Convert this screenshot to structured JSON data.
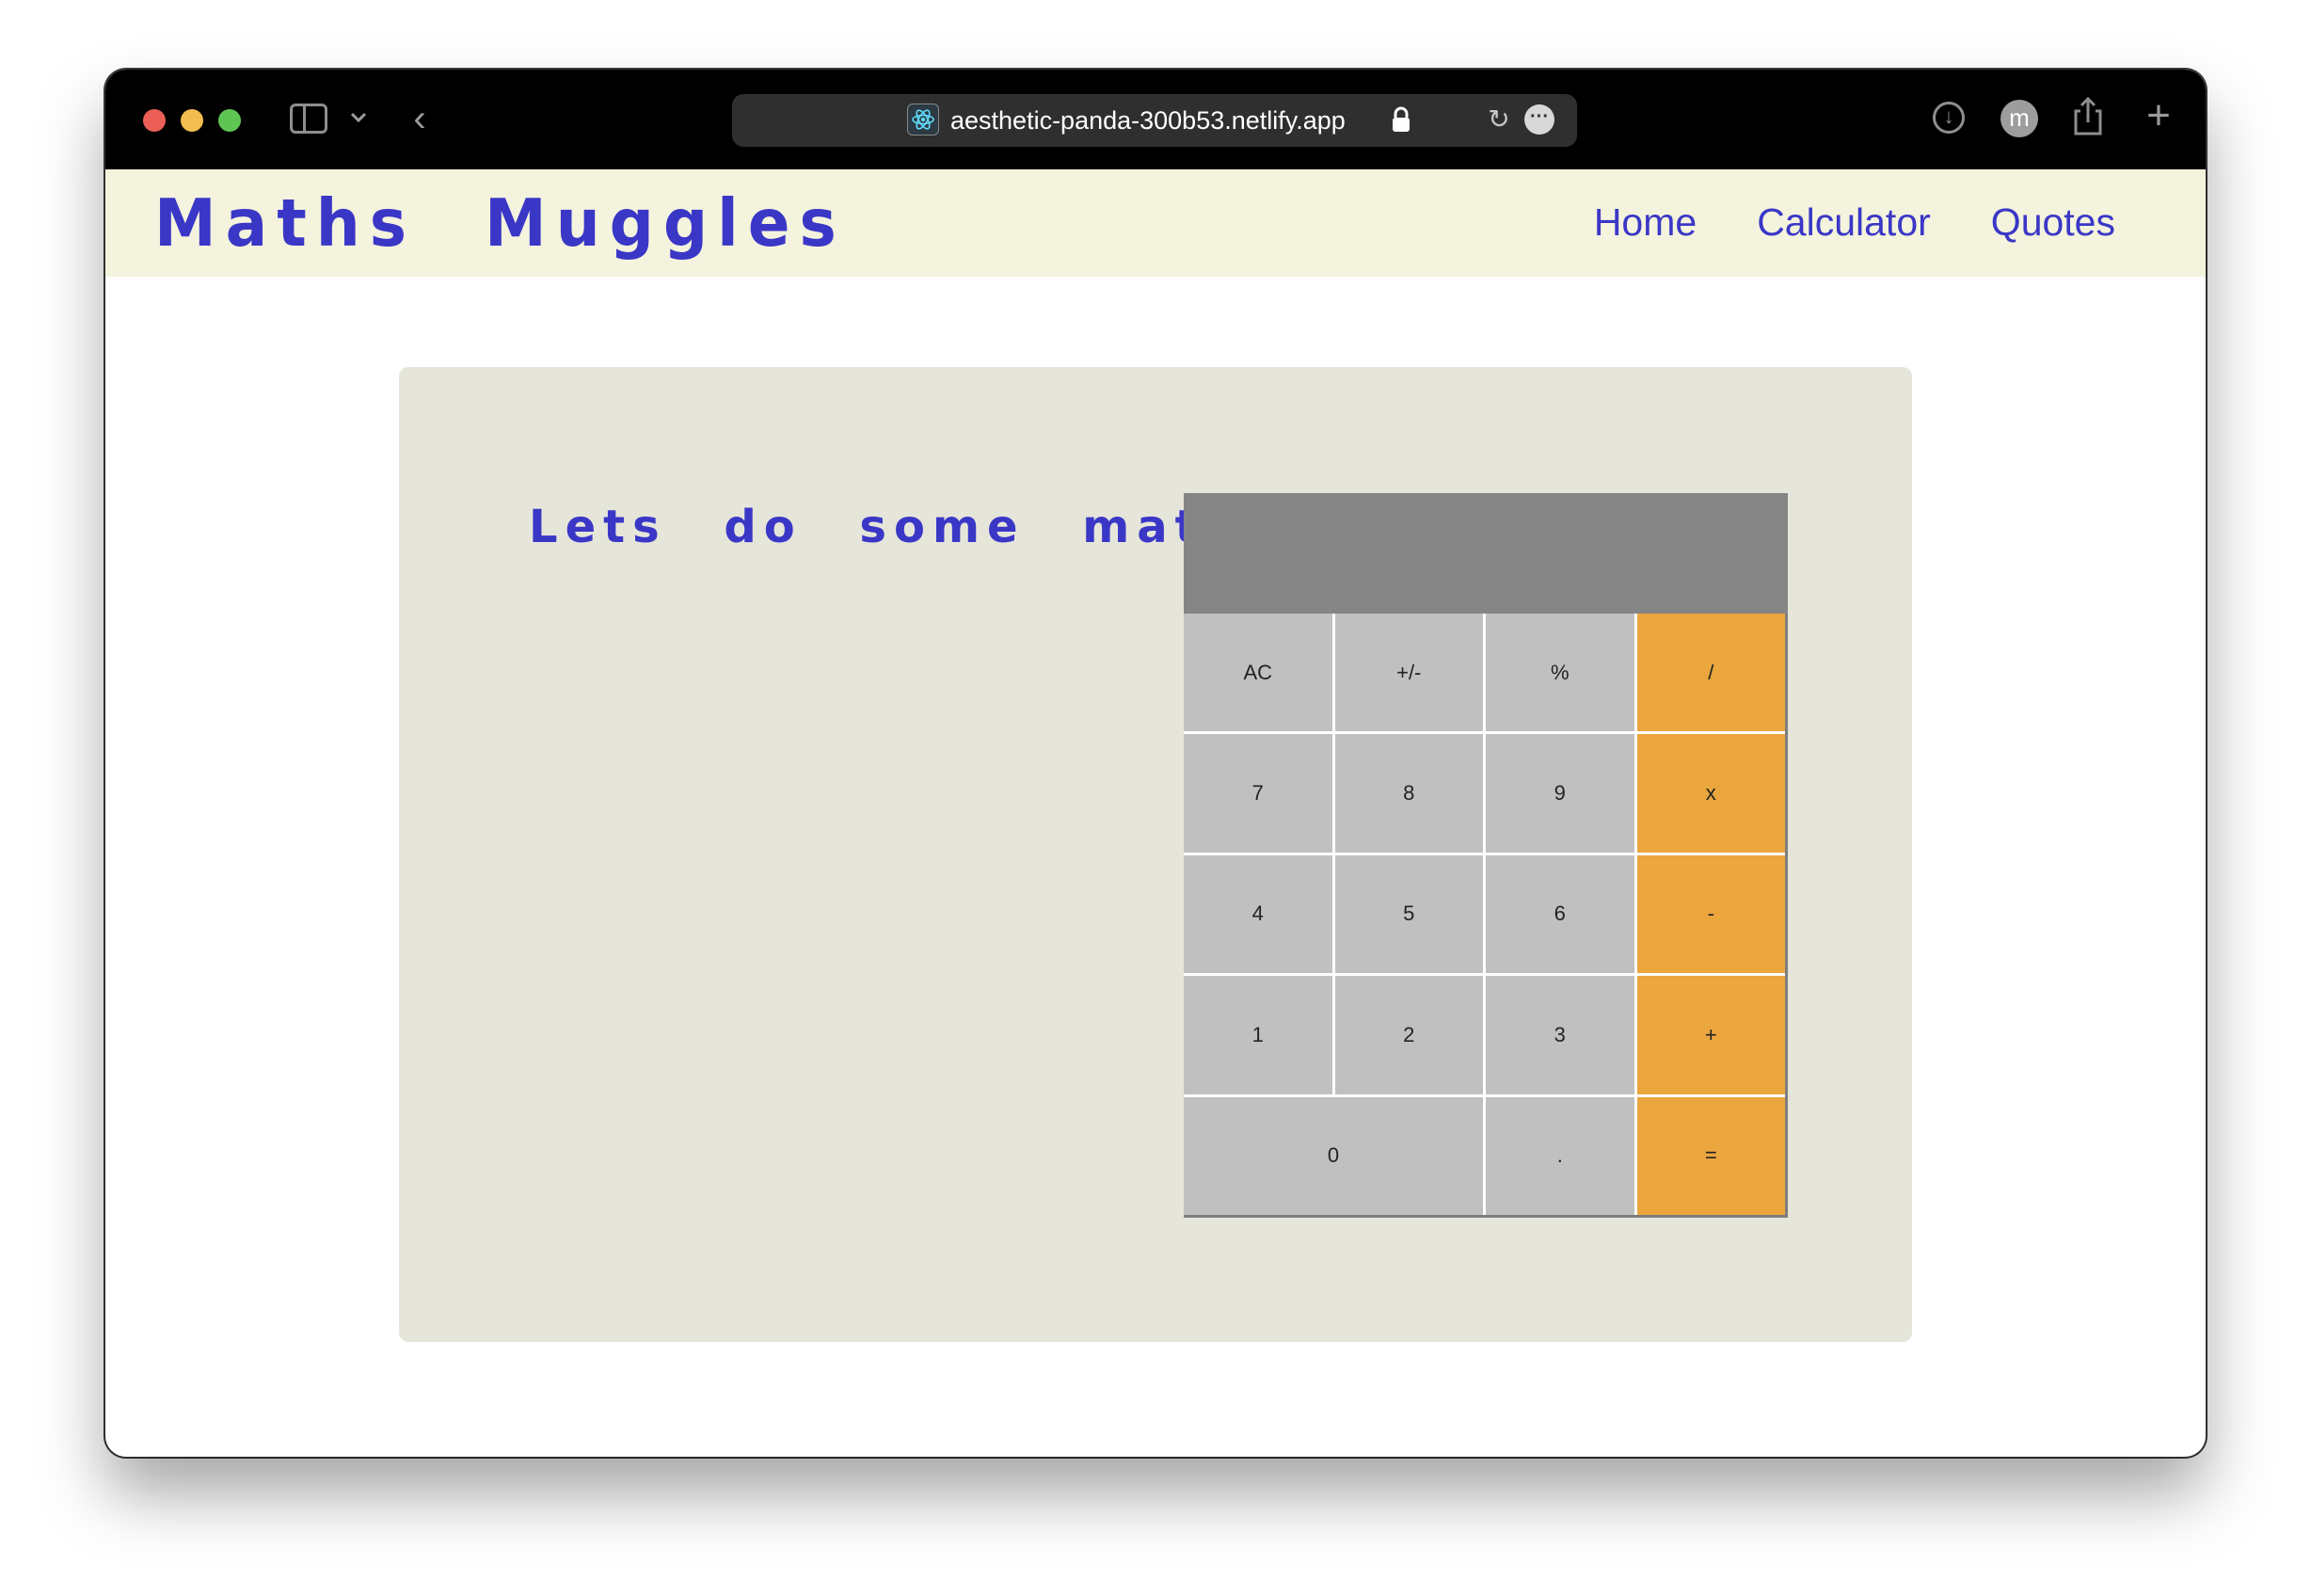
{
  "browser": {
    "url": "aesthetic-panda-300b53.netlify.app",
    "site_icon": "react-atom-icon",
    "avatar_initial": "m",
    "icons": {
      "back": "‹",
      "reload": "↻",
      "more": "···",
      "download": "↓",
      "new_tab": "+"
    }
  },
  "navbar": {
    "brand": "Maths Muggles",
    "links": [
      "Home",
      "Calculator",
      "Quotes"
    ]
  },
  "main": {
    "tagline": "Lets do some maths!!"
  },
  "calculator": {
    "display": "",
    "keys": [
      {
        "label": "AC",
        "type": "func"
      },
      {
        "label": "+/-",
        "type": "func"
      },
      {
        "label": "%",
        "type": "func"
      },
      {
        "label": "/",
        "type": "op"
      },
      {
        "label": "7",
        "type": "num"
      },
      {
        "label": "8",
        "type": "num"
      },
      {
        "label": "9",
        "type": "num"
      },
      {
        "label": "x",
        "type": "op"
      },
      {
        "label": "4",
        "type": "num"
      },
      {
        "label": "5",
        "type": "num"
      },
      {
        "label": "6",
        "type": "num"
      },
      {
        "label": "-",
        "type": "op"
      },
      {
        "label": "1",
        "type": "num"
      },
      {
        "label": "2",
        "type": "num"
      },
      {
        "label": "3",
        "type": "num"
      },
      {
        "label": "+",
        "type": "op"
      },
      {
        "label": "0",
        "type": "num"
      },
      {
        "label": ".",
        "type": "num"
      },
      {
        "label": "=",
        "type": "op"
      }
    ]
  },
  "colors": {
    "accent": "#3a37c7",
    "navbar_bg": "#f4f3dd",
    "panel_bg": "#e6e5da",
    "display_bg": "#858585",
    "key_bg": "#c0c0c0",
    "operator_bg": "#eba63e"
  }
}
